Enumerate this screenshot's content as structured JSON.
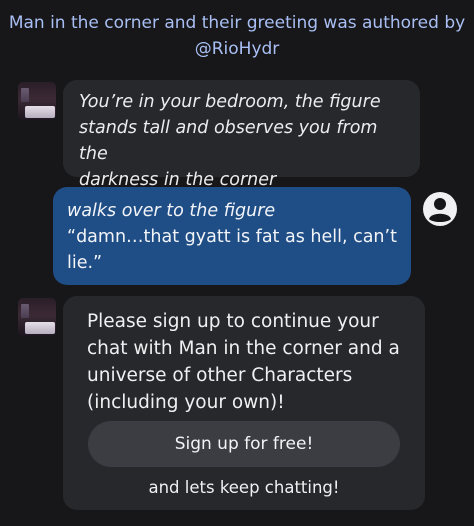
{
  "header": {
    "line1": "Man in the corner and their greeting was authored by",
    "line2": "@RioHydr"
  },
  "messages": [
    {
      "role": "character",
      "lines": [
        "You’re in your bedroom, the figure",
        "stands tall and observes you from the",
        "darkness in the corner"
      ]
    },
    {
      "role": "user",
      "lines": [
        "walks over to the figure",
        "“damn…that gyatt is fat as hell, can’t",
        "lie.”"
      ]
    }
  ],
  "signup_prompt": {
    "lines": [
      "Please sign up to continue your",
      "chat with Man in the corner  and a",
      "universe of other Characters",
      "(including your own)!"
    ],
    "button_label": "Sign up for free!",
    "footer": "and lets keep chatting!"
  },
  "icons": {
    "character_avatar": "dark-bedroom-avatar",
    "user_avatar": "user-icon"
  },
  "colors": {
    "background": "#17171a",
    "character_bubble": "#27282c",
    "user_bubble": "#1f4d86",
    "header_text": "#a9bff4",
    "button": "#3b3d43"
  }
}
